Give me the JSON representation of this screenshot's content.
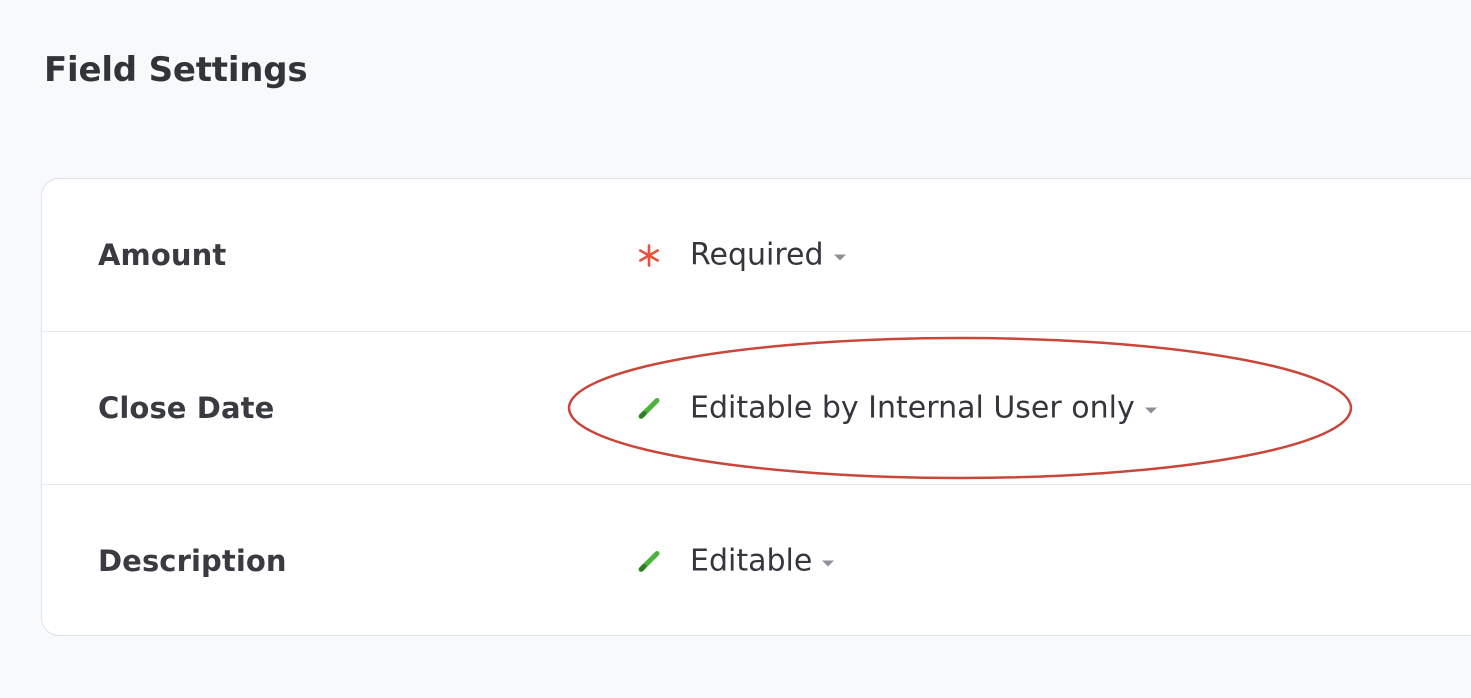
{
  "section": {
    "title": "Field Settings"
  },
  "fields": [
    {
      "name": "Amount",
      "permission": "Required",
      "icon": "asterisk-icon",
      "icon_color": "#e5533d"
    },
    {
      "name": "Close Date",
      "permission": "Editable by Internal User only",
      "icon": "pencil-icon",
      "icon_color": "#4db33d"
    },
    {
      "name": "Description",
      "permission": "Editable",
      "icon": "pencil-icon",
      "icon_color": "#4db33d"
    }
  ],
  "annotation": {
    "color": "#c9473a"
  }
}
